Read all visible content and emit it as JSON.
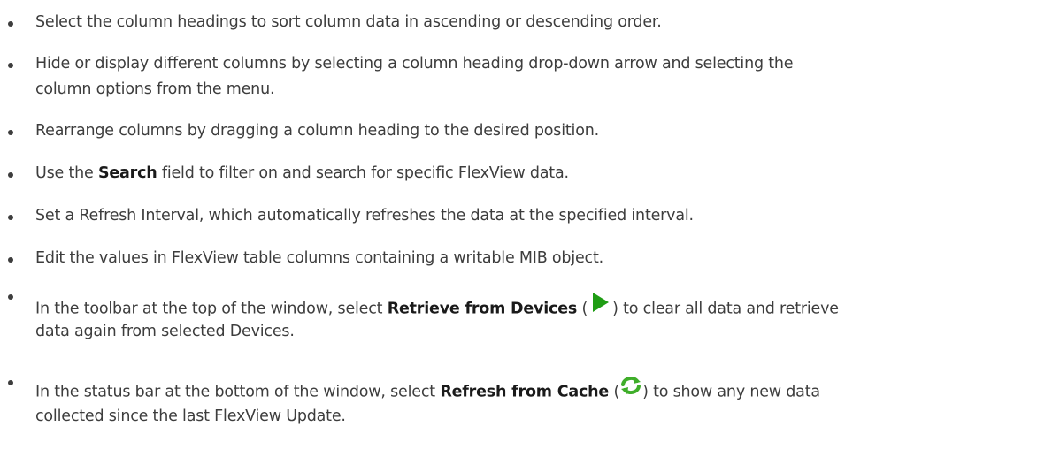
{
  "items": [
    {
      "text": "Select the column headings to sort column data in ascending or descending order."
    },
    {
      "line1": "Hide or display different columns by selecting a column heading drop-down arrow and selecting the",
      "line2": "column options from the menu."
    },
    {
      "text": "Rearrange columns by dragging a column heading to the desired position."
    },
    {
      "before": "Use the ",
      "strong": "Search",
      "after": " field to filter on and search for specific FlexView data."
    },
    {
      "text": "Set a Refresh Interval, which automatically refreshes the data at the specified interval."
    },
    {
      "text": "Edit the values in FlexView table columns containing a writable MIB object."
    },
    {
      "before": "In the toolbar at the top of the window, select ",
      "strong": "Retrieve from Devices",
      "open": " (",
      "close": ") to clear all data and retrieve",
      "line2": "data again from selected Devices.",
      "icon": "play-icon",
      "icon_color": "#1f9d14"
    },
    {
      "before": "In the status bar at the bottom of the window, select ",
      "strong": "Refresh from Cache",
      "open": " (",
      "close": ") to show any new data",
      "line2": "collected since the last FlexView Update.",
      "icon": "refresh-icon",
      "icon_color": "#3fae2a"
    }
  ]
}
